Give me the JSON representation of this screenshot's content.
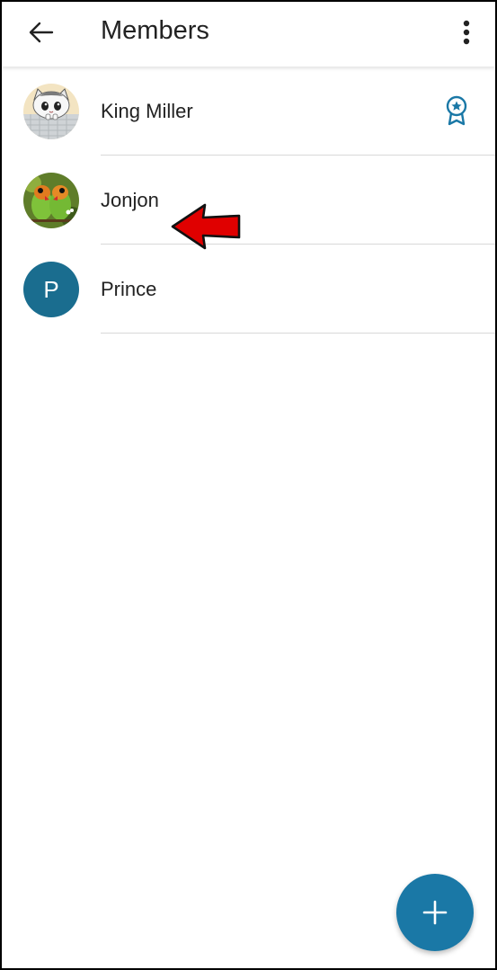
{
  "header": {
    "title": "Members",
    "back_icon": "arrow-left-icon",
    "menu_icon": "more-vert-icon"
  },
  "members": [
    {
      "name": "King Miller",
      "avatar": "cat-photo",
      "badge": "award-icon"
    },
    {
      "name": "Jonjon",
      "avatar": "parrots-photo"
    },
    {
      "name": "Prince",
      "avatar_letter": "P"
    }
  ],
  "fab": {
    "icon": "plus-icon"
  },
  "colors": {
    "accent": "#1a78a6",
    "avatar_letter_bg": "#1a6d8f",
    "annotation_arrow": "#e00000"
  }
}
